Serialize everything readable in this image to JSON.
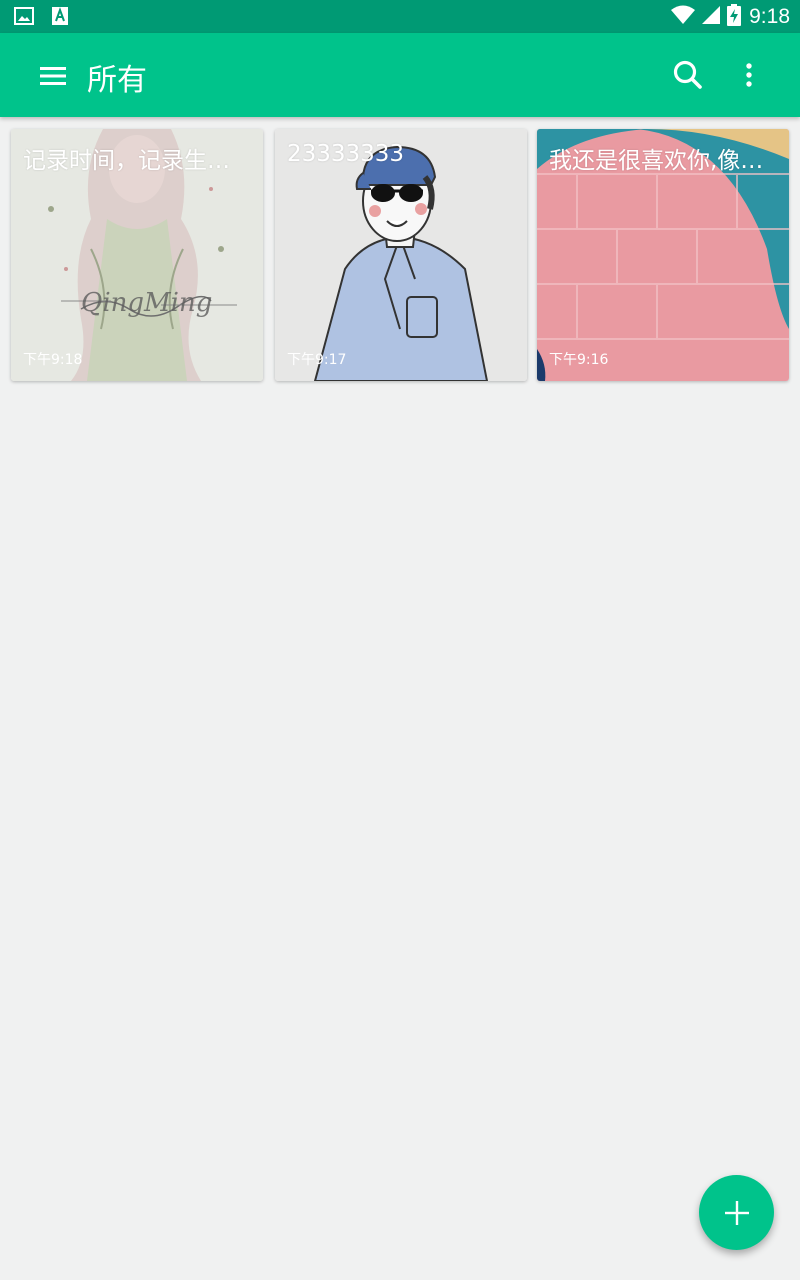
{
  "status_bar": {
    "time": "9:18",
    "left_icons": [
      "image-notification-icon",
      "text-notification-icon"
    ],
    "right_icons": [
      "wifi-icon",
      "cell-signal-icon",
      "battery-charging-icon"
    ]
  },
  "app_bar": {
    "title": "所有",
    "background": "#00C38B",
    "icons": [
      "menu-icon",
      "search-icon",
      "more-vert-icon"
    ]
  },
  "notes": [
    {
      "title": "记录时间，记录生…",
      "time": "下午9:18",
      "image": "girl-sketch-qingming"
    },
    {
      "title": "23333333",
      "time": "下午9:17",
      "image": "boy-cartoon-cap-sunglasses"
    },
    {
      "title": "我还是很喜欢你,像…",
      "time": "下午9:16",
      "image": "colorful-brick-wall"
    }
  ],
  "fab": {
    "icon": "plus-icon",
    "color": "#00C38B"
  }
}
